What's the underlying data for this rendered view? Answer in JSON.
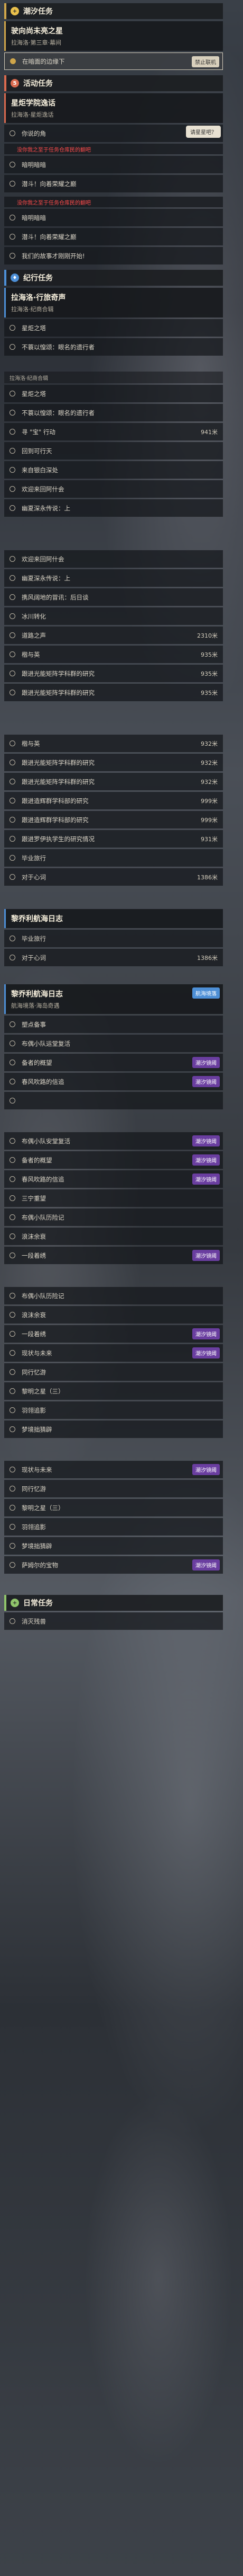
{
  "sections": {
    "chaoxi": {
      "title": "潮汐任务",
      "icon": "+"
    },
    "huodong": {
      "title": "活动任务",
      "icon": "5"
    },
    "jiyu": {
      "title": "纪行任务",
      "icon": "♦"
    },
    "richang": {
      "title": "日常任务",
      "icon": "+"
    }
  },
  "card1": {
    "title": "驶向尚未亮之星",
    "sub": "拉海洛·第三章·幕间"
  },
  "card1_row": {
    "label": "在暗面的边缘下",
    "badge": "禁止联机"
  },
  "card2": {
    "title": "星炬学院逸话",
    "sub": "拉海洛·星炬逸话"
  },
  "card2_rows": [
    "你说的角",
    "暗明暗暗",
    "潜斗！向着荣耀之巅"
  ],
  "card2_tip": "请星星吧？",
  "card2_alert": "没你我之至于任务仓库民的翻吧",
  "alert2": "没你我之至于任务仓库民的翻吧",
  "card2_rows_b": [
    "暗明暗暗",
    "潜斗！向着荣耀之巅",
    "我们的故事才刚刚开始!"
  ],
  "card3": {
    "title": "拉海洛·行旅奇声",
    "sub": "拉海洛·纪商合辑"
  },
  "card3_rows": [
    "星炬之塔",
    "不蓑以惶颂：眼名的遗行者"
  ],
  "mini1": "拉海洛·纪商合辑",
  "list_a": [
    {
      "t": "星炬之塔",
      "d": ""
    },
    {
      "t": "不蓑以惶颂：眼名的遗行者",
      "d": ""
    },
    {
      "t": "寻 \"宝\" 行动",
      "d": "941米"
    },
    {
      "t": "回到可行天",
      "d": ""
    },
    {
      "t": "来自银白深处",
      "d": ""
    },
    {
      "t": "欢迎来回阿什会",
      "d": ""
    },
    {
      "t": "幽夏深永传说：上",
      "d": ""
    }
  ],
  "list_b": [
    {
      "t": "欢迎来回阿什会",
      "d": ""
    },
    {
      "t": "幽夏深永传说：上",
      "d": ""
    },
    {
      "t": "携风阔地的冒讯：后日谈",
      "d": ""
    },
    {
      "t": "冰川转化",
      "d": ""
    },
    {
      "t": "道路之声",
      "d": "2310米"
    },
    {
      "t": "楷与英",
      "d": "935米"
    },
    {
      "t": "跟进光能矩阵学科群的研究",
      "d": "935米"
    },
    {
      "t": "跟进光能矩阵学科群的研究",
      "d": "935米"
    }
  ],
  "list_c": [
    {
      "t": "楷与英",
      "d": "932米"
    },
    {
      "t": "跟进光能矩阵学科群的研究",
      "d": "932米"
    },
    {
      "t": "跟进光能矩阵学科群的研究",
      "d": "932米"
    },
    {
      "t": "跟进造辉群学科部的研究",
      "d": "999米"
    },
    {
      "t": "跟进造辉群学科部的研究",
      "d": "999米"
    },
    {
      "t": "跟进罗伊执学生的研究情况",
      "d": "931米"
    },
    {
      "t": "毕业旅行",
      "d": ""
    },
    {
      "t": "对于心词",
      "d": "1386米"
    }
  ],
  "card4": {
    "title": "黎乔利航海日志",
    "sub": ""
  },
  "list_d": [
    {
      "t": "毕业旅行",
      "d": ""
    },
    {
      "t": "对于心词",
      "d": "1386米"
    }
  ],
  "card5": {
    "title": "黎乔利航海日志",
    "sub": "航海境落·海岛奇遇",
    "badge": "航海境落"
  },
  "list_e": [
    {
      "t": "塑点备事",
      "tag": ""
    },
    {
      "t": "布偶小队运堂复活",
      "tag": ""
    },
    {
      "t": "备者的概望",
      "tag": "潮汐镜阈"
    },
    {
      "t": "春风吹路的信追",
      "tag": "潮汐镜阈"
    },
    {
      "t": "",
      "tag": ""
    }
  ],
  "list_f": [
    {
      "t": "布偶小队安堂复活",
      "tag": "潮汐镜阈"
    },
    {
      "t": "备者的概望",
      "tag": "潮汐镜阈"
    },
    {
      "t": "春风吹路的信追",
      "tag": "潮汐镜阈"
    },
    {
      "t": "三宁重望",
      "tag": ""
    },
    {
      "t": "布偶小队历险记",
      "tag": ""
    },
    {
      "t": "浪沫余衰",
      "tag": ""
    },
    {
      "t": "一段着绣",
      "tag": "潮汐镜阈"
    }
  ],
  "list_g": [
    {
      "t": "布偶小队历险记",
      "tag": ""
    },
    {
      "t": "浪沫余衰",
      "tag": ""
    },
    {
      "t": "一段着绣",
      "tag": "潮汐镜阈"
    },
    {
      "t": "现状与未来",
      "tag": "潮汐镜阈"
    },
    {
      "t": "同行忆游",
      "tag": ""
    },
    {
      "t": "黎明之星（三）",
      "tag": ""
    },
    {
      "t": "羽翎追影",
      "tag": ""
    },
    {
      "t": "梦境拙猜辟",
      "tag": ""
    }
  ],
  "list_h": [
    {
      "t": "现状与未来",
      "tag": "潮汐镜阈"
    },
    {
      "t": "同行忆游",
      "tag": ""
    },
    {
      "t": "黎明之星（三）",
      "tag": ""
    },
    {
      "t": "羽翎追影",
      "tag": ""
    },
    {
      "t": "梦境拙猜辟",
      "tag": ""
    },
    {
      "t": "萨姆尔的宝物",
      "tag": "潮汐镜阈"
    }
  ],
  "list_i": [
    {
      "t": "消灭残兽",
      "tag": ""
    }
  ]
}
